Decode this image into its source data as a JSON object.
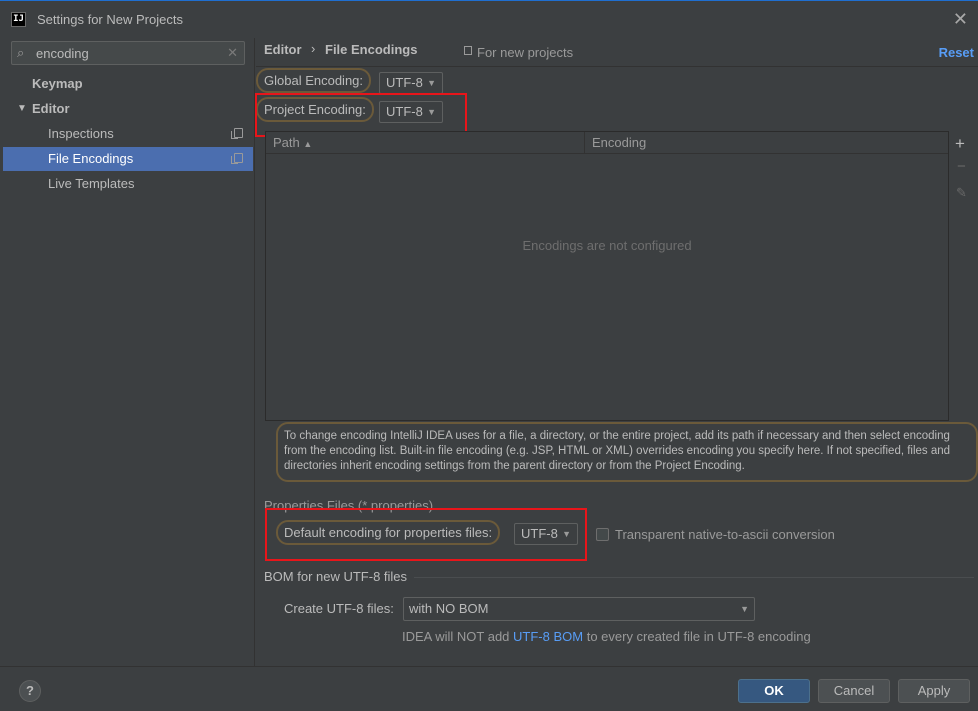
{
  "window": {
    "title": "Settings for New Projects",
    "app_icon_text": "IJ",
    "close_glyph": "✕"
  },
  "sidebar": {
    "search": {
      "value": "encoding",
      "placeholder": ""
    },
    "items": [
      {
        "label": "Keymap"
      },
      {
        "label": "Editor"
      },
      {
        "label": "Inspections"
      },
      {
        "label": "File Encodings"
      },
      {
        "label": "Live Templates"
      }
    ]
  },
  "header": {
    "breadcrumb": [
      "Editor",
      "File Encodings"
    ],
    "separator": "›",
    "scope": "For new projects",
    "reset": "Reset"
  },
  "encodings": {
    "global_label": "Global Encoding:",
    "global_value": "UTF-8",
    "project_label": "Project Encoding:",
    "project_value": "UTF-8"
  },
  "table": {
    "columns": [
      "Path",
      "Encoding"
    ],
    "sort_glyph": "▲",
    "empty_text": "Encodings are not configured"
  },
  "toolbar": {
    "add": "+",
    "remove": "−",
    "edit": "✎"
  },
  "help_text": "To change encoding IntelliJ IDEA uses for a file, a directory, or the entire project, add its path if necessary and then select encoding from the encoding list. Built-in file encoding (e.g. JSP, HTML or XML) overrides encoding you specify here. If not specified, files and directories inherit encoding settings from the parent directory or from the Project Encoding.",
  "properties": {
    "section_title": "Properties Files (*.properties)",
    "default_label": "Default encoding for properties files:",
    "default_value": "UTF-8",
    "transparent_label": "Transparent native-to-ascii conversion"
  },
  "bom": {
    "section_title": "BOM for new UTF-8 files",
    "create_label": "Create UTF-8 files:",
    "create_value": "with NO BOM",
    "note_prefix": "IDEA will NOT add ",
    "note_link": "UTF-8 BOM",
    "note_suffix": " to every created file in UTF-8 encoding"
  },
  "footer": {
    "help": "?",
    "ok": "OK",
    "cancel": "Cancel",
    "apply": "Apply"
  },
  "colors": {
    "accent": "#4b6eaf",
    "link": "#589df6",
    "highlight_red": "#e8151a"
  }
}
